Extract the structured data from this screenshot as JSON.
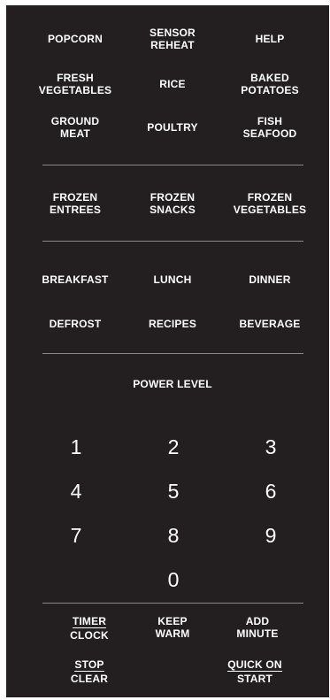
{
  "colors": {
    "panel_background": "#231f20",
    "text": "#ffffff",
    "divider": "#8a8788"
  },
  "buttons": {
    "popcorn": [
      "POPCORN"
    ],
    "sensor_reheat": [
      "SENSOR",
      "REHEAT"
    ],
    "help": [
      "HELP"
    ],
    "fresh_vegetables": [
      "FRESH",
      "VEGETABLES"
    ],
    "rice": [
      "RICE"
    ],
    "baked_potatoes": [
      "BAKED",
      "POTATOES"
    ],
    "ground_meat": [
      "GROUND",
      "MEAT"
    ],
    "poultry": [
      "POULTRY"
    ],
    "fish_seafood": [
      "FISH",
      "SEAFOOD"
    ],
    "frozen_entrees": [
      "FROZEN",
      "ENTREES"
    ],
    "frozen_snacks": [
      "FROZEN",
      "SNACKS"
    ],
    "frozen_vegetables": [
      "FROZEN",
      "VEGETABLES"
    ],
    "breakfast": [
      "BREAKFAST"
    ],
    "lunch": [
      "LUNCH"
    ],
    "dinner": [
      "DINNER"
    ],
    "defrost": [
      "DEFROST"
    ],
    "recipes": [
      "RECIPES"
    ],
    "beverage": [
      "BEVERAGE"
    ],
    "power_level": [
      "POWER LEVEL"
    ],
    "timer_clock": [
      "TIMER",
      "CLOCK"
    ],
    "keep_warm": [
      "KEEP",
      "WARM"
    ],
    "add_minute": [
      "ADD",
      "MINUTE"
    ],
    "stop_clear": [
      "STOP",
      "CLEAR"
    ],
    "quick_on_start": [
      "QUICK ON",
      "START"
    ]
  },
  "keypad": [
    "1",
    "2",
    "3",
    "4",
    "5",
    "6",
    "7",
    "8",
    "9",
    "0"
  ]
}
